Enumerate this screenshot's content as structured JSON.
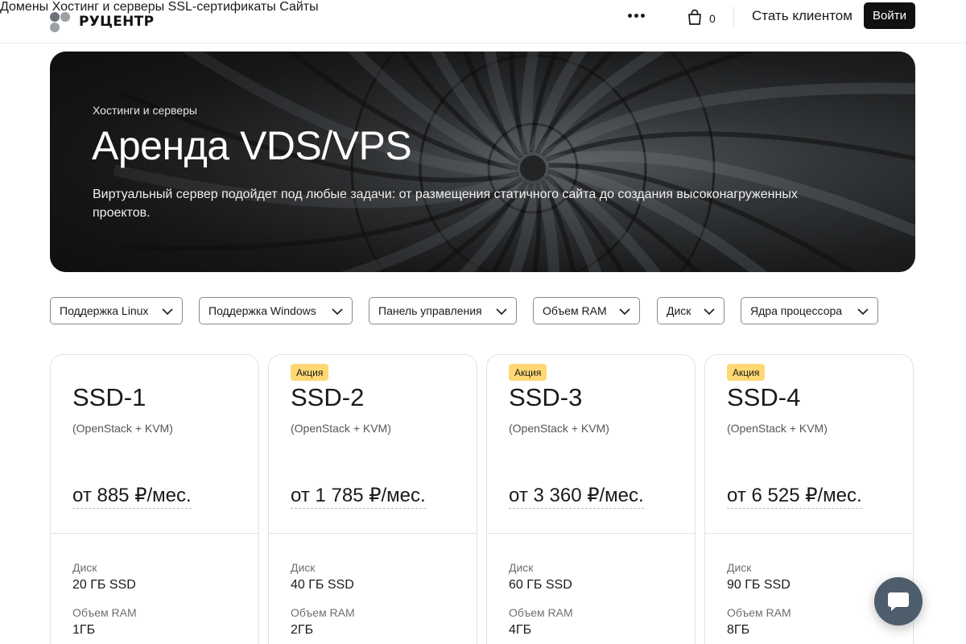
{
  "header": {
    "logo_text": "РУЦЕНТР",
    "nav": [
      "Домены",
      "Хостинг и серверы",
      "SSL-сертификаты",
      "Сайты"
    ],
    "more_icon": "more-dots-icon",
    "cart_icon": "shopping-bag-icon",
    "cart_count": "0",
    "become_client": "Стать клиентом",
    "login": "Войти"
  },
  "hero": {
    "breadcrumb": "Хостинги и серверы",
    "title": "Аренда VDS/VPS",
    "description": "Виртуальный сервер подойдет под любые задачи: от размещения статичного сайта до создания высоконагруженных проектов."
  },
  "filters": [
    "Поддержка Linux",
    "Поддержка Windows",
    "Панель управления",
    "Объем RAM",
    "Диск",
    "Ядра процессора"
  ],
  "plans": [
    {
      "badge": "",
      "name": "SSD-1",
      "sub": "(OpenStack + KVM)",
      "price": "от 885 ₽/мес.",
      "disk_label": "Диск",
      "disk": "20 ГБ SSD",
      "ram_label": "Объем RAM",
      "ram": "1ГБ"
    },
    {
      "badge": "Акция",
      "name": "SSD-2",
      "sub": "(OpenStack + KVM)",
      "price": "от 1 785 ₽/мес.",
      "disk_label": "Диск",
      "disk": "40 ГБ SSD",
      "ram_label": "Объем RAM",
      "ram": "2ГБ"
    },
    {
      "badge": "Акция",
      "name": "SSD-3",
      "sub": "(OpenStack + KVM)",
      "price": "от 3 360 ₽/мес.",
      "disk_label": "Диск",
      "disk": "60 ГБ SSD",
      "ram_label": "Объем RAM",
      "ram": "4ГБ"
    },
    {
      "badge": "Акция",
      "name": "SSD-4",
      "sub": "(OpenStack + KVM)",
      "price": "от 6 525 ₽/мес.",
      "disk_label": "Диск",
      "disk": "90 ГБ SSD",
      "ram_label": "Объем RAM",
      "ram": "8ГБ"
    }
  ],
  "chat_icon": "chat-bubble-icon",
  "colors": {
    "accent_dark": "#111111",
    "badge": "#ffd873",
    "chat": "#4e5d6c"
  }
}
